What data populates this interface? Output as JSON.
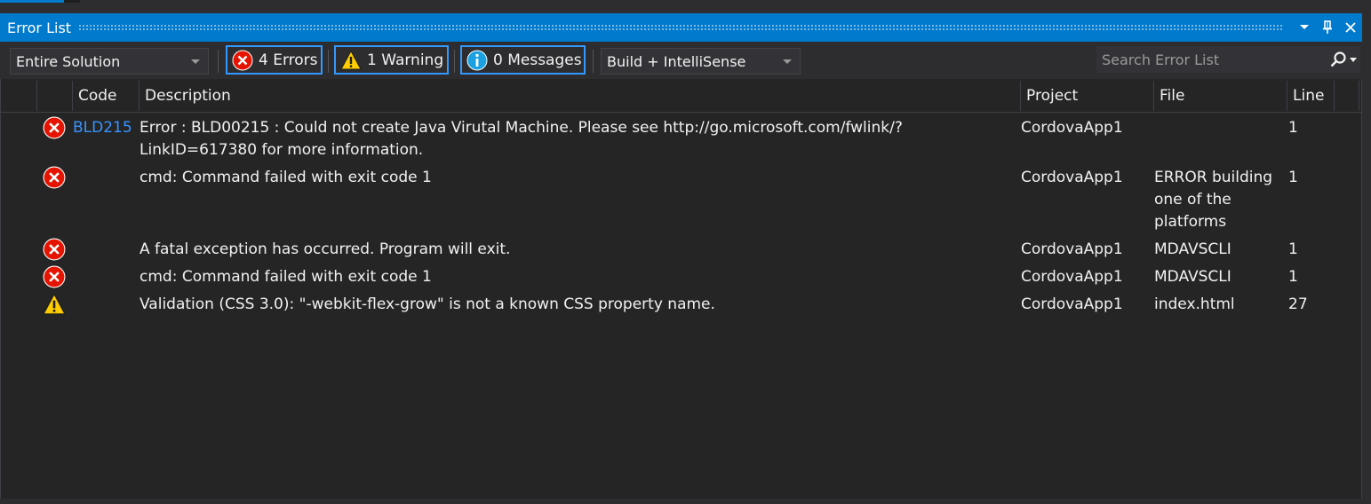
{
  "window": {
    "title": "Error List",
    "buttons": {
      "dropdown": "window-position-icon",
      "pin": "pin-icon",
      "close": "close-icon"
    }
  },
  "toolbar": {
    "scope": {
      "value": "Entire Solution"
    },
    "errors_label": "4 Errors",
    "warnings_label": "1 Warning",
    "messages_label": "0 Messages",
    "source": {
      "value": "Build + IntelliSense"
    },
    "search": {
      "placeholder": "Search Error List"
    }
  },
  "columns": {
    "code": "Code",
    "description": "Description",
    "project": "Project",
    "file": "File",
    "line": "Line"
  },
  "rows": [
    {
      "severity": "error",
      "code": "BLD215",
      "description": "Error : BLD00215 : Could not create Java Virutal Machine. Please see http://go.microsoft.com/fwlink/?LinkID=617380 for more information.",
      "project": "CordovaApp1",
      "file": "",
      "line": "1"
    },
    {
      "severity": "error",
      "code": "",
      "description": "cmd: Command failed with exit code 1",
      "project": "CordovaApp1",
      "file": "ERROR building one of the platforms",
      "line": "1"
    },
    {
      "severity": "error",
      "code": "",
      "description": "A fatal exception has occurred. Program will exit.",
      "project": "CordovaApp1",
      "file": "MDAVSCLI",
      "line": "1"
    },
    {
      "severity": "error",
      "code": "",
      "description": "cmd: Command failed with exit code 1",
      "project": "CordovaApp1",
      "file": "MDAVSCLI",
      "line": "1"
    },
    {
      "severity": "warning",
      "code": "",
      "description": "Validation (CSS 3.0): \"-webkit-flex-grow\" is not a known CSS property name.",
      "project": "CordovaApp1",
      "file": "index.html",
      "line": "27"
    }
  ],
  "colors": {
    "accent": "#007acc",
    "error": "#e51400",
    "warning": "#ffcc00",
    "info": "#1ba1e2",
    "link": "#3794ff"
  }
}
